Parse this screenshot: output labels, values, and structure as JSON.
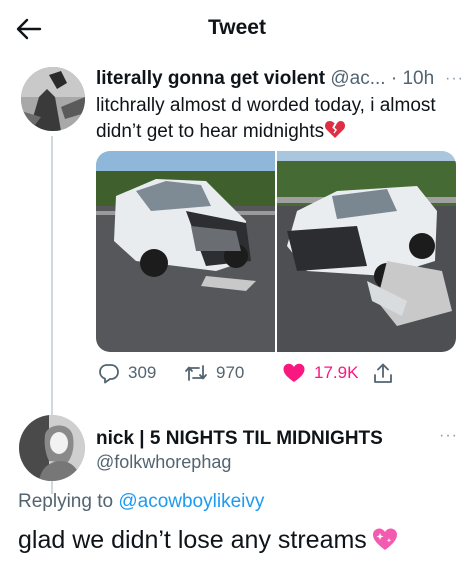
{
  "header": {
    "title": "Tweet"
  },
  "tweet": {
    "name": "literally gonna get violent",
    "handle_time": "@ac... · 10h",
    "more": "···",
    "text": "litchrally almost d worded today, i almost didn’t get to hear midnights",
    "emoji": "broken-heart",
    "actions": {
      "replies": "309",
      "retweets": "970",
      "likes": "17.9K"
    },
    "liked": true
  },
  "reply": {
    "name": "nick | 5 NIGHTS TIL MIDNIGHTS",
    "handle": "@folkwhorephag",
    "more": "···",
    "replying_prefix": "Replying to ",
    "replying_to": "@acowboylikeivy",
    "text": "glad we didn’t lose any streams",
    "emoji": "sparkling-heart"
  },
  "colors": {
    "accent_blue": "#1d9bf0",
    "like_pink": "#f91880",
    "muted_gray": "#536471",
    "thread_line": "#cfd9de"
  }
}
